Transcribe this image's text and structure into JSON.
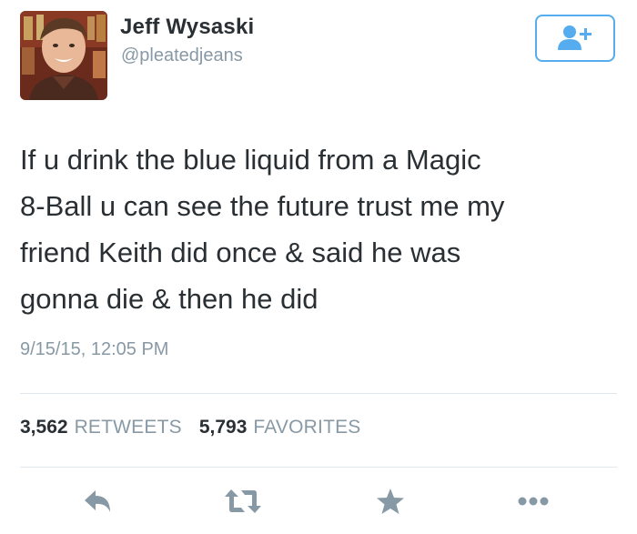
{
  "user": {
    "display_name": "Jeff Wysaski",
    "handle": "@pleatedjeans"
  },
  "follow_button": {
    "icon": "add-user-icon",
    "color": "#55acee"
  },
  "tweet": {
    "text": "If u drink the blue liquid from a Magic\n8-Ball u can see the future trust me my\nfriend Keith did once & said he was\ngonna die & then he did",
    "timestamp": "9/15/15, 12:05 PM"
  },
  "stats": {
    "retweets_count": "3,562",
    "retweets_label": "RETWEETS",
    "favorites_count": "5,793",
    "favorites_label": "FAVORITES"
  },
  "actions": {
    "reply_icon": "reply-icon",
    "retweet_icon": "retweet-icon",
    "favorite_icon": "star-icon",
    "more_icon": "more-icon"
  },
  "colors": {
    "text": "#292f33",
    "muted": "#8899a6",
    "accent": "#55acee",
    "divider": "#e1e8ed"
  }
}
